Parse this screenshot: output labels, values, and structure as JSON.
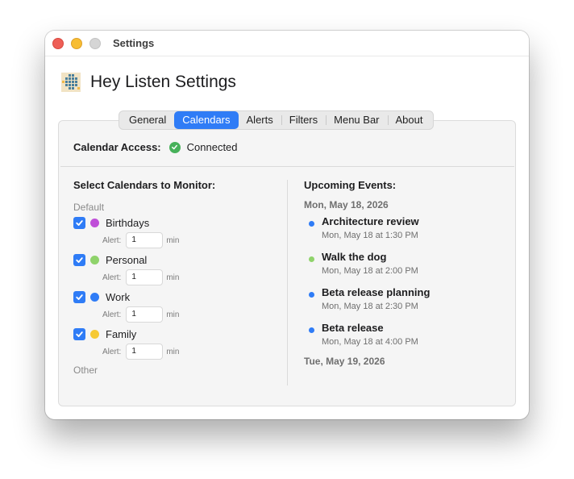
{
  "window": {
    "title": "Settings"
  },
  "app": {
    "title": "Hey Listen Settings"
  },
  "tabs": [
    {
      "label": "General",
      "active": false
    },
    {
      "label": "Calendars",
      "active": true
    },
    {
      "label": "Alerts",
      "active": false
    },
    {
      "label": "Filters",
      "active": false
    },
    {
      "label": "Menu Bar",
      "active": false
    },
    {
      "label": "About",
      "active": false
    }
  ],
  "access": {
    "label": "Calendar Access:",
    "status": "Connected",
    "status_color": "#47b15a"
  },
  "calendars": {
    "title": "Select Calendars to Monitor:",
    "groups": [
      {
        "name": "Default",
        "items": [
          {
            "name": "Birthdays",
            "checked": true,
            "color": "#bf4fd8",
            "alert_label": "Alert:",
            "alert_value": "1",
            "alert_unit": "min"
          },
          {
            "name": "Personal",
            "checked": true,
            "color": "#8fd36b",
            "alert_label": "Alert:",
            "alert_value": "1",
            "alert_unit": "min"
          },
          {
            "name": "Work",
            "checked": true,
            "color": "#2f7cf6",
            "alert_label": "Alert:",
            "alert_value": "1",
            "alert_unit": "min"
          },
          {
            "name": "Family",
            "checked": true,
            "color": "#f6c935",
            "alert_label": "Alert:",
            "alert_value": "1",
            "alert_unit": "min"
          }
        ]
      },
      {
        "name": "Other",
        "items": []
      }
    ]
  },
  "events": {
    "title": "Upcoming Events:",
    "days": [
      {
        "date": "Mon, May 18, 2026",
        "items": [
          {
            "title": "Architecture review",
            "time": "Mon, May 18 at 1:30 PM",
            "color": "#2f7cf6"
          },
          {
            "title": "Walk the dog",
            "time": "Mon, May 18 at 2:00 PM",
            "color": "#8fd36b"
          },
          {
            "title": "Beta release planning",
            "time": "Mon, May 18 at 2:30 PM",
            "color": "#2f7cf6"
          },
          {
            "title": "Beta release",
            "time": "Mon, May 18 at 4:00 PM",
            "color": "#2f7cf6"
          }
        ]
      },
      {
        "date": "Tue, May 19, 2026",
        "items": []
      }
    ]
  }
}
